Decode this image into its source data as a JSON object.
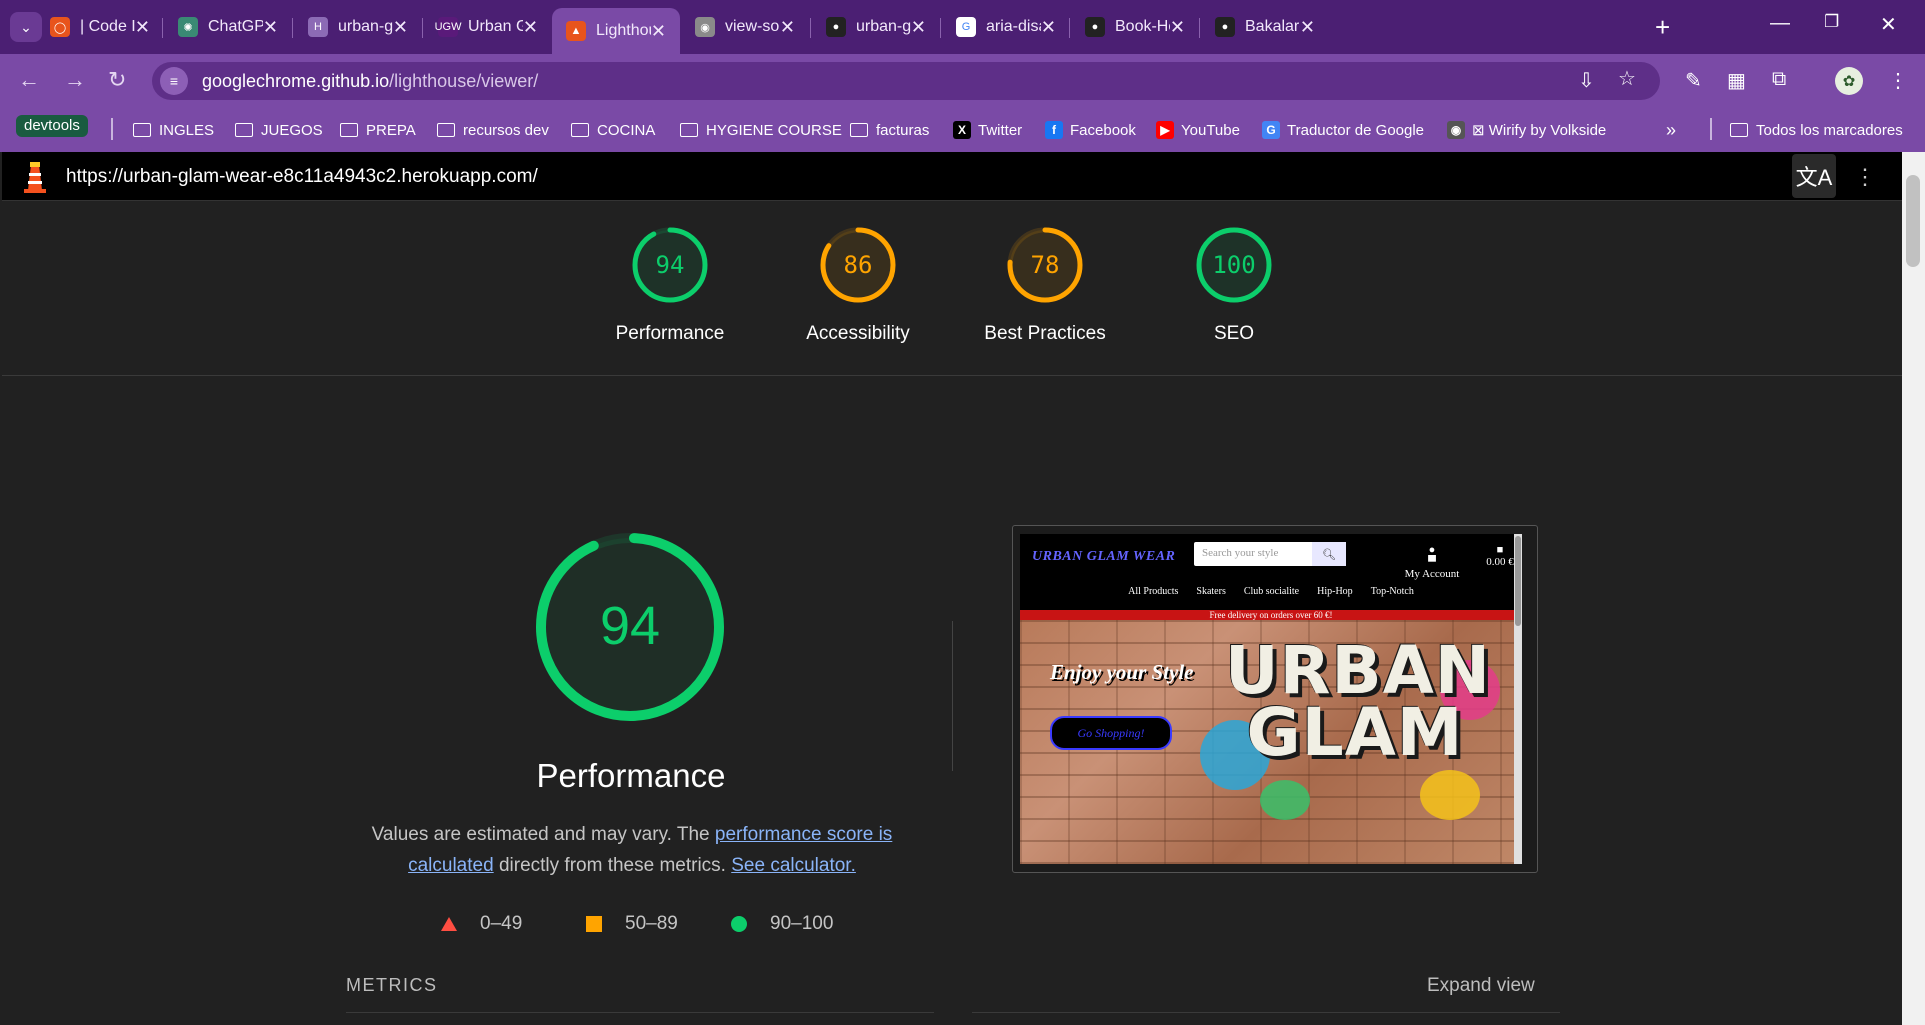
{
  "tabs": [
    {
      "title": "| Code Inst",
      "fav_color": "#e8541c",
      "fav_glyph": "◯"
    },
    {
      "title": "ChatGPT",
      "fav_color": "#3a8a74",
      "fav_glyph": "✺"
    },
    {
      "title": "urban-glan",
      "fav_color": "#8c6bb5",
      "fav_glyph": "H"
    },
    {
      "title": "Urban Glan",
      "fav_color": "#5a1a7a",
      "fav_glyph": "UGW"
    },
    {
      "title": "Lighthouse",
      "fav_color": "#e8541c",
      "fav_glyph": "▲",
      "active": true
    },
    {
      "title": "view-sourc",
      "fav_color": "#8a8a8a",
      "fav_glyph": "◉"
    },
    {
      "title": "urban-glan",
      "fav_color": "#222222",
      "fav_glyph": "●"
    },
    {
      "title": "aria-disabl",
      "fav_color": "#ffffff",
      "fav_glyph": "G"
    },
    {
      "title": "Book-Heav",
      "fav_color": "#222222",
      "fav_glyph": "●"
    },
    {
      "title": "Bakalar-bo",
      "fav_color": "#222222",
      "fav_glyph": "●"
    }
  ],
  "omnibox": {
    "host": "googlechrome.github.io",
    "path": "/lighthouse/viewer/"
  },
  "bookmarks": {
    "devtools": "devtools",
    "items": [
      "INGLES",
      "JUEGOS",
      "PREPA",
      "recursos dev",
      "COCINA",
      "HYGIENE COURSE",
      "facturas",
      "Twitter",
      "Facebook",
      "YouTube",
      "Traductor de Google",
      "⊠ Wirify by Volkside"
    ],
    "overflow": "»",
    "all": "Todos los marcadores"
  },
  "viewer": {
    "url": "https://urban-glam-wear-e8c11a4943c2.herokuapp.com/"
  },
  "scores": [
    {
      "label": "Performance",
      "value": 94,
      "color": "#0cce6b"
    },
    {
      "label": "Accessibility",
      "value": 86,
      "color": "#ffa400"
    },
    {
      "label": "Best Practices",
      "value": 78,
      "color": "#ffa400"
    },
    {
      "label": "SEO",
      "value": 100,
      "color": "#0cce6b"
    }
  ],
  "performance": {
    "score": 94,
    "title": "Performance",
    "desc_pre": "Values are estimated and may vary. The ",
    "desc_link1": "performance score is calculated",
    "desc_mid": " directly from these metrics. ",
    "desc_link2": "See calculator.",
    "legend": [
      {
        "range": "0–49",
        "color": "#ff4e42",
        "shape": "triangle"
      },
      {
        "range": "50–89",
        "color": "#ffa400",
        "shape": "square"
      },
      {
        "range": "90–100",
        "color": "#0cce6b",
        "shape": "circle"
      }
    ]
  },
  "screenshot": {
    "brand": "URBAN GLAM WEAR",
    "search_placeholder": "Search your style",
    "account": "My Account",
    "cart": "0.00 €",
    "nav": [
      "All Products",
      "Skaters",
      "Club socialite",
      "Hip-Hop",
      "Top-Notch"
    ],
    "delivery": "Free delivery on orders over 60 €!",
    "hero_tagline": "Enjoy your Style",
    "hero_button": "Go Shopping!",
    "hero_logo_line1": "URBAN",
    "hero_logo_line2": "GLAM"
  },
  "metrics": {
    "label": "METRICS",
    "expand": "Expand view"
  }
}
